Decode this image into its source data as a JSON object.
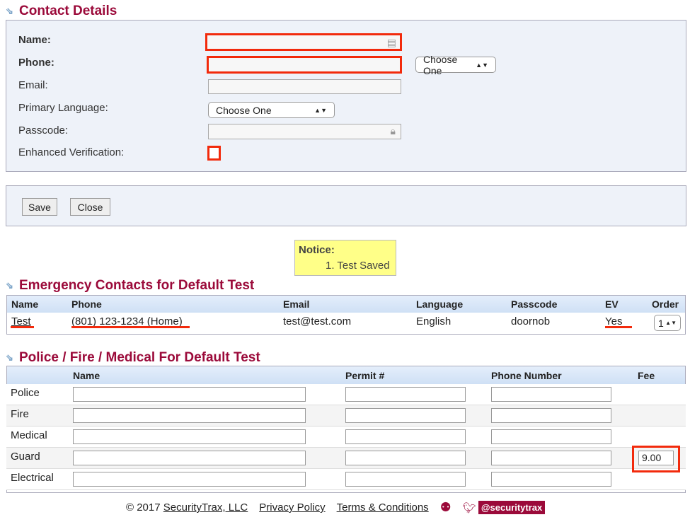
{
  "contact": {
    "title": "Contact Details",
    "name_label": "Name:",
    "phone_label": "Phone:",
    "email_label": "Email:",
    "language_label": "Primary Language:",
    "passcode_label": "Passcode:",
    "ev_label": "Enhanced Verification:",
    "phone_type": "Choose One",
    "language": "Choose One"
  },
  "buttons": {
    "save": "Save",
    "close": "Close"
  },
  "notice": {
    "title": "Notice:",
    "items": [
      "1. Test Saved"
    ]
  },
  "emergency": {
    "title": "Emergency Contacts for Default Test",
    "columns": [
      "Name",
      "Phone",
      "Email",
      "Language",
      "Passcode",
      "EV",
      "Order"
    ],
    "rows": [
      {
        "name": "Test",
        "phone": "(801) 123-1234 (Home)",
        "email": "test@test.com",
        "language": "English",
        "passcode": "doornob",
        "ev": "Yes",
        "order": "1"
      }
    ]
  },
  "pfm": {
    "title": "Police / Fire / Medical For Default Test",
    "columns": [
      "Name",
      "Permit #",
      "Phone Number",
      "Fee"
    ],
    "rows": [
      {
        "label": "Police"
      },
      {
        "label": "Fire"
      },
      {
        "label": "Medical"
      },
      {
        "label": "Guard",
        "fee": "9.00"
      },
      {
        "label": "Electrical"
      }
    ]
  },
  "footer": {
    "copyright": "© 2017",
    "company": "SecurityTrax, LLC",
    "privacy": "Privacy Policy",
    "terms": "Terms & Conditions",
    "twitter": "@securitytrax"
  },
  "colors": {
    "accent": "#9b0a3a",
    "highlight": "#f22a0c",
    "notice_bg": "#ffff88"
  }
}
